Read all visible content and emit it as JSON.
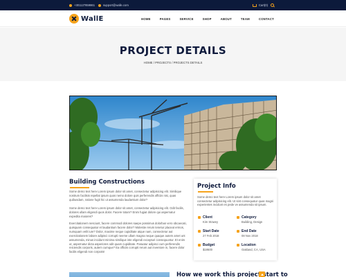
{
  "topbar": {
    "phone": "+301127859861",
    "email": "support@walle.com",
    "cart": "Cart(0)"
  },
  "brand": {
    "name": "WallE"
  },
  "nav": [
    "HOME",
    "PAGES",
    "SERVICE",
    "SHOP",
    "ABOUT",
    "TEAM",
    "CONTACT"
  ],
  "hero": {
    "title": "PROJECT DETAILS",
    "breadcrumb": [
      "HOME",
      "PROJECTS",
      "PROJECTS DETAILS"
    ],
    "separator": " / "
  },
  "main": {
    "section_title": "Building Constructions",
    "paragraphs": [
      "Some demo text here Lorem ipsum dolor sit amet, consectetur adipisicing elit. Similique nostrum facilisis repellat ipsum quos nemo dolore quis perferendis officiis nisi, quas quibusdam, ratione fugit hic ut assumenda laudantium dolor?",
      "Some demo text here Lorem ipsum dolor sit amet, consectetur adipisicing elit. Odit facilis, dolores ullam eligendi quos dolor. Facere totam? Enim fugiat dolore qui aspernatur expedita maiores?",
      "Exercitationem nesciunt, facere commodi dolores saepe possimus dolorbus vero obcaecati, quisquam consequatur et laudantium facere dolor? Molestie rerum tenetur placeat ermos, numquam velit iure? Dolor, maxime neque cupiditate atque nam, consectetur aut exercitationem labore adipisci corrupti neeme ullam magna neque quaque autem amet unt assumenda, minus incidunt minima similique iste eligendi excepturi consequuntur. Et enim ut, aspernatur dicta asperiores odit quam cupiditate. Paraatur adipisci cum perferendis reiciendis corporis, autem cumque? Ea officiis corrupti rerum aut inventore in, facere dolor facilis eligendi non corporis!"
    ]
  },
  "project_info": {
    "title": "Project Info",
    "description": "Some demo text here Lorem ipsum dolor sit amet consectetur adipisicing elit. Ut sint consequatur quas magni experientes incidunt es pede ve assumenda sit ipsum.",
    "items": [
      {
        "label": "Client",
        "value": "Kim Stowey",
        "icon": "user-icon"
      },
      {
        "label": "Category",
        "value": "Building, Design",
        "icon": "folder-icon"
      },
      {
        "label": "Start Date",
        "value": "27 Feb 2018",
        "icon": "calendar-icon"
      },
      {
        "label": "End Date",
        "value": "08 Nov 2018",
        "icon": "calendar-icon"
      },
      {
        "label": "Budget",
        "value": "$19500",
        "icon": "money-icon"
      },
      {
        "label": "Location",
        "value": "Oakland, CA, USA",
        "icon": "location-icon"
      }
    ]
  },
  "bottom": {
    "heading": "How we work this project start to"
  },
  "colors": {
    "navy": "#0c1a3b",
    "accent": "#f6a31b",
    "hero_bg": "#f5f5f5"
  }
}
